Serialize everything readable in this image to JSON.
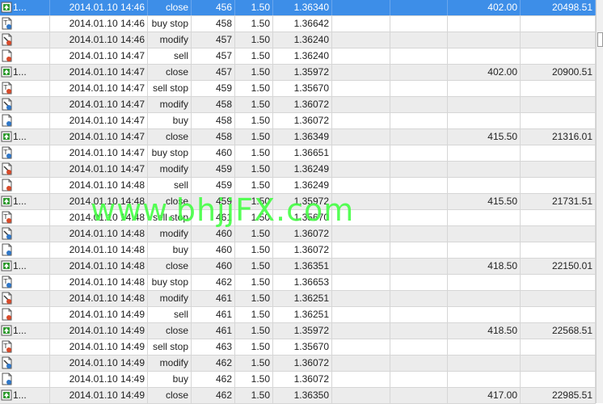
{
  "watermark": "www.bhjjFX.com",
  "colors": {
    "selected_row": "#3d8ee8",
    "alt_row": "#ececec",
    "watermark": "#44ff44",
    "close_icon": "#2f9a2f",
    "buy_icon": "#2f77c8",
    "sell_icon": "#d84a2a"
  },
  "rows": [
    {
      "id": "1...",
      "time": "2014.01.10 14:46",
      "type": "close",
      "order": "456",
      "volume": "1.50",
      "price": "1.36340",
      "sl": "",
      "tp": "",
      "profit": "402.00",
      "balance": "20498.51",
      "icon": "close-trade-icon",
      "selected": true
    },
    {
      "id": "",
      "time": "2014.01.10 14:46",
      "type": "buy stop",
      "order": "458",
      "volume": "1.50",
      "price": "1.36642",
      "sl": "",
      "tp": "",
      "profit": "",
      "balance": "",
      "icon": "buy-pending-icon"
    },
    {
      "id": "",
      "time": "2014.01.10 14:46",
      "type": "modify",
      "order": "457",
      "volume": "1.50",
      "price": "1.36240",
      "sl": "",
      "tp": "",
      "profit": "",
      "balance": "",
      "icon": "modify-sell-icon"
    },
    {
      "id": "",
      "time": "2014.01.10 14:47",
      "type": "sell",
      "order": "457",
      "volume": "1.50",
      "price": "1.36240",
      "sl": "",
      "tp": "",
      "profit": "",
      "balance": "",
      "icon": "sell-icon"
    },
    {
      "id": "1...",
      "time": "2014.01.10 14:47",
      "type": "close",
      "order": "457",
      "volume": "1.50",
      "price": "1.35972",
      "sl": "",
      "tp": "",
      "profit": "402.00",
      "balance": "20900.51",
      "icon": "close-trade-icon"
    },
    {
      "id": "",
      "time": "2014.01.10 14:47",
      "type": "sell stop",
      "order": "459",
      "volume": "1.50",
      "price": "1.35670",
      "sl": "",
      "tp": "",
      "profit": "",
      "balance": "",
      "icon": "sell-pending-icon"
    },
    {
      "id": "",
      "time": "2014.01.10 14:47",
      "type": "modify",
      "order": "458",
      "volume": "1.50",
      "price": "1.36072",
      "sl": "",
      "tp": "",
      "profit": "",
      "balance": "",
      "icon": "modify-buy-icon"
    },
    {
      "id": "",
      "time": "2014.01.10 14:47",
      "type": "buy",
      "order": "458",
      "volume": "1.50",
      "price": "1.36072",
      "sl": "",
      "tp": "",
      "profit": "",
      "balance": "",
      "icon": "buy-icon"
    },
    {
      "id": "1...",
      "time": "2014.01.10 14:47",
      "type": "close",
      "order": "458",
      "volume": "1.50",
      "price": "1.36349",
      "sl": "",
      "tp": "",
      "profit": "415.50",
      "balance": "21316.01",
      "icon": "close-trade-icon"
    },
    {
      "id": "",
      "time": "2014.01.10 14:47",
      "type": "buy stop",
      "order": "460",
      "volume": "1.50",
      "price": "1.36651",
      "sl": "",
      "tp": "",
      "profit": "",
      "balance": "",
      "icon": "buy-pending-icon"
    },
    {
      "id": "",
      "time": "2014.01.10 14:47",
      "type": "modify",
      "order": "459",
      "volume": "1.50",
      "price": "1.36249",
      "sl": "",
      "tp": "",
      "profit": "",
      "balance": "",
      "icon": "modify-sell-icon"
    },
    {
      "id": "",
      "time": "2014.01.10 14:48",
      "type": "sell",
      "order": "459",
      "volume": "1.50",
      "price": "1.36249",
      "sl": "",
      "tp": "",
      "profit": "",
      "balance": "",
      "icon": "sell-icon"
    },
    {
      "id": "1...",
      "time": "2014.01.10 14:48",
      "type": "close",
      "order": "459",
      "volume": "1.50",
      "price": "1.35972",
      "sl": "",
      "tp": "",
      "profit": "415.50",
      "balance": "21731.51",
      "icon": "close-trade-icon"
    },
    {
      "id": "",
      "time": "2014.01.10 14:48",
      "type": "sell stop",
      "order": "461",
      "volume": "1.50",
      "price": "1.35670",
      "sl": "",
      "tp": "",
      "profit": "",
      "balance": "",
      "icon": "sell-pending-icon"
    },
    {
      "id": "",
      "time": "2014.01.10 14:48",
      "type": "modify",
      "order": "460",
      "volume": "1.50",
      "price": "1.36072",
      "sl": "",
      "tp": "",
      "profit": "",
      "balance": "",
      "icon": "modify-buy-icon"
    },
    {
      "id": "",
      "time": "2014.01.10 14:48",
      "type": "buy",
      "order": "460",
      "volume": "1.50",
      "price": "1.36072",
      "sl": "",
      "tp": "",
      "profit": "",
      "balance": "",
      "icon": "buy-icon"
    },
    {
      "id": "1...",
      "time": "2014.01.10 14:48",
      "type": "close",
      "order": "460",
      "volume": "1.50",
      "price": "1.36351",
      "sl": "",
      "tp": "",
      "profit": "418.50",
      "balance": "22150.01",
      "icon": "close-trade-icon"
    },
    {
      "id": "",
      "time": "2014.01.10 14:48",
      "type": "buy stop",
      "order": "462",
      "volume": "1.50",
      "price": "1.36653",
      "sl": "",
      "tp": "",
      "profit": "",
      "balance": "",
      "icon": "buy-pending-icon"
    },
    {
      "id": "",
      "time": "2014.01.10 14:48",
      "type": "modify",
      "order": "461",
      "volume": "1.50",
      "price": "1.36251",
      "sl": "",
      "tp": "",
      "profit": "",
      "balance": "",
      "icon": "modify-sell-icon"
    },
    {
      "id": "",
      "time": "2014.01.10 14:49",
      "type": "sell",
      "order": "461",
      "volume": "1.50",
      "price": "1.36251",
      "sl": "",
      "tp": "",
      "profit": "",
      "balance": "",
      "icon": "sell-icon"
    },
    {
      "id": "1...",
      "time": "2014.01.10 14:49",
      "type": "close",
      "order": "461",
      "volume": "1.50",
      "price": "1.35972",
      "sl": "",
      "tp": "",
      "profit": "418.50",
      "balance": "22568.51",
      "icon": "close-trade-icon"
    },
    {
      "id": "",
      "time": "2014.01.10 14:49",
      "type": "sell stop",
      "order": "463",
      "volume": "1.50",
      "price": "1.35670",
      "sl": "",
      "tp": "",
      "profit": "",
      "balance": "",
      "icon": "sell-pending-icon"
    },
    {
      "id": "",
      "time": "2014.01.10 14:49",
      "type": "modify",
      "order": "462",
      "volume": "1.50",
      "price": "1.36072",
      "sl": "",
      "tp": "",
      "profit": "",
      "balance": "",
      "icon": "modify-buy-icon"
    },
    {
      "id": "",
      "time": "2014.01.10 14:49",
      "type": "buy",
      "order": "462",
      "volume": "1.50",
      "price": "1.36072",
      "sl": "",
      "tp": "",
      "profit": "",
      "balance": "",
      "icon": "buy-icon"
    },
    {
      "id": "1...",
      "time": "2014.01.10 14:49",
      "type": "close",
      "order": "462",
      "volume": "1.50",
      "price": "1.36350",
      "sl": "",
      "tp": "",
      "profit": "417.00",
      "balance": "22985.51",
      "icon": "close-trade-icon"
    }
  ]
}
